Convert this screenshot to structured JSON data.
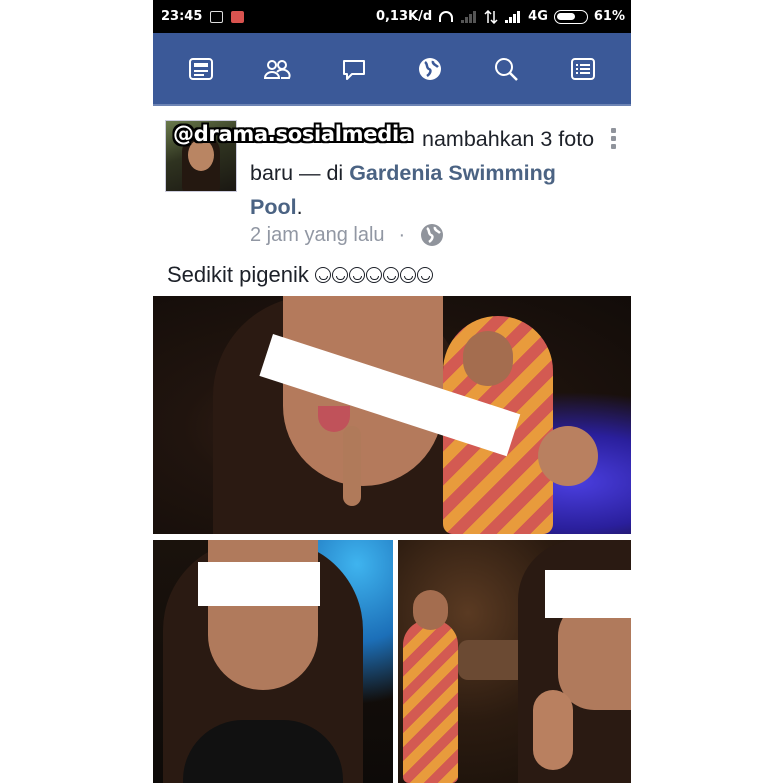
{
  "status_bar": {
    "time": "23:45",
    "speed": "0,13K/d",
    "network": "4G",
    "battery": "61%"
  },
  "nav": {
    "icons": [
      "news-feed-icon",
      "friends-icon",
      "messages-icon",
      "notifications-globe-icon",
      "search-icon",
      "menu-icon"
    ],
    "background": "#3b5998"
  },
  "post": {
    "watermark": "@drama.sosialmedia",
    "action_text": "nambahkan 3 foto baru — di ",
    "place": "Gardenia Swimming Pool",
    "place_suffix": ".",
    "time": "2 jam yang lalu",
    "separator": "·",
    "privacy_icon": "globe-icon",
    "caption": "Sedikit pigenik",
    "caption_emojis": 7,
    "photo_count": 3,
    "place_color": "#4b6383"
  }
}
